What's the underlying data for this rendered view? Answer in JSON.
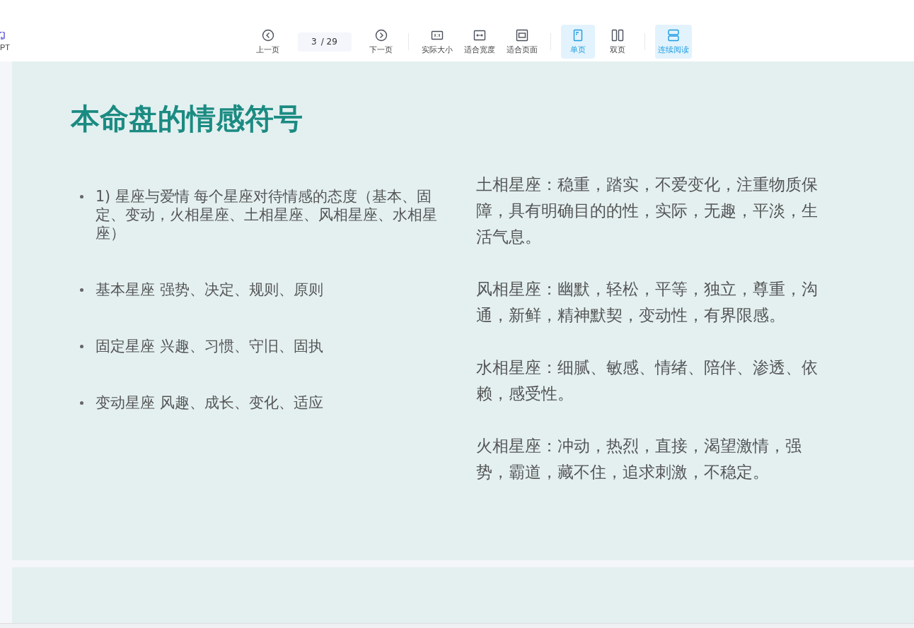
{
  "toolbar": {
    "left_item": {
      "label": "PT"
    },
    "groups": [
      [
        {
          "kind": "prev",
          "label": "上一页",
          "selected": false
        },
        {
          "kind": "page",
          "value": "3",
          "total": "/ 29"
        },
        {
          "kind": "next",
          "label": "下一页",
          "selected": false
        }
      ],
      [
        {
          "kind": "actual",
          "label": "实际大小",
          "selected": false
        },
        {
          "kind": "fitwidth",
          "label": "适合宽度",
          "selected": false
        },
        {
          "kind": "fitpage",
          "label": "适合页面",
          "selected": false
        }
      ],
      [
        {
          "kind": "single",
          "label": "单页",
          "selected": true
        },
        {
          "kind": "double",
          "label": "双页",
          "selected": false
        }
      ],
      [
        {
          "kind": "continuous",
          "label": "连续阅读",
          "selected": true
        }
      ]
    ]
  },
  "slides": [
    {
      "title": "本命盘的情感符号",
      "bullets": [
        "1) 星座与爱情 每个星座对待情感的态度（基本、固定、变动，火相星座、土相星座、风相星座、水相星座）",
        "基本星座 强势、决定、规则、原则",
        "固定星座 兴趣、习惯、守旧、固执",
        "变动星座 风趣、成长、变化、适应"
      ],
      "paragraphs": [
        "土相星座：稳重，踏实，不爱变化，注重物质保障，具有明确目的的性，实际，无趣，平淡，生活气息。",
        "风相星座：幽默，轻松，平等，独立，尊重，沟通，新鲜，精神默契，变动性，有界限感。",
        "水相星座：细腻、敏感、情绪、陪伴、渗透、依赖，感受性。",
        "火相星座：冲动，热烈，直接，渴望激情，强势，霸道，藏不住，追求刺激，不稳定。"
      ]
    }
  ]
}
